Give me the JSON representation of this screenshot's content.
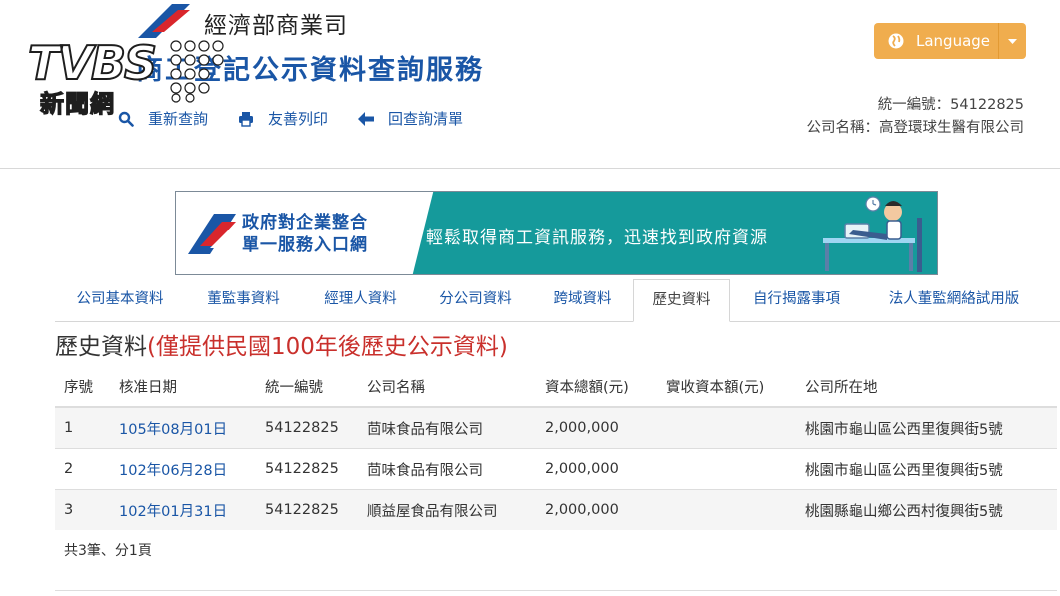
{
  "header": {
    "dept_name": "經濟部商業司",
    "service_title": "商工登記公示資料查詢服務",
    "tvbs_logo": "TVBS",
    "tvbs_news": "新聞網",
    "toolbar": [
      {
        "icon": "search-icon",
        "label": "重新查詢"
      },
      {
        "icon": "print-icon",
        "label": "友善列印"
      },
      {
        "icon": "arrow-left-icon",
        "label": "回查詢清單"
      }
    ],
    "language_label": "Language",
    "language_icon": "globe-icon",
    "company_id_line": "統一編號：54122825",
    "company_name_line": "公司名稱：高登環球生醫有限公司"
  },
  "banner": {
    "left_line1": "政府對企業整合",
    "left_line2": "單一服務入口網",
    "right_text": "輕鬆取得商工資訊服務，迅速找到政府資源",
    "teal_color": "#159a9b"
  },
  "tabs": [
    {
      "label": "公司基本資料"
    },
    {
      "label": "董監事資料"
    },
    {
      "label": "經理人資料"
    },
    {
      "label": "分公司資料"
    },
    {
      "label": "跨域資料"
    },
    {
      "label": "歷史資料"
    },
    {
      "label": "自行揭露事項"
    },
    {
      "label": "法人董監網絡試用版"
    }
  ],
  "section": {
    "title": "歷史資料",
    "note": "(僅提供民國100年後歷史公示資料)"
  },
  "table": {
    "headers": [
      "序號",
      "核准日期",
      "統一編號",
      "公司名稱",
      "資本總額(元)",
      "實收資本額(元)",
      "公司所在地"
    ],
    "rows": [
      {
        "no": "1",
        "date": "105年08月01日",
        "id": "54122825",
        "name": "茴味食品有限公司",
        "capital": "2,000,000",
        "paid": "",
        "address": "桃園市龜山區公西里復興街5號"
      },
      {
        "no": "2",
        "date": "102年06月28日",
        "id": "54122825",
        "name": "茴味食品有限公司",
        "capital": "2,000,000",
        "paid": "",
        "address": "桃園市龜山區公西里復興街5號"
      },
      {
        "no": "3",
        "date": "102年01月31日",
        "id": "54122825",
        "name": "順益屋食品有限公司",
        "capital": "2,000,000",
        "paid": "",
        "address": "桃園縣龜山鄉公西村復興街5號"
      }
    ]
  },
  "summary": "共3筆、分1頁",
  "colors": {
    "link": "#1a56a6",
    "accent": "#f0ad4e",
    "note": "#c9302c"
  }
}
